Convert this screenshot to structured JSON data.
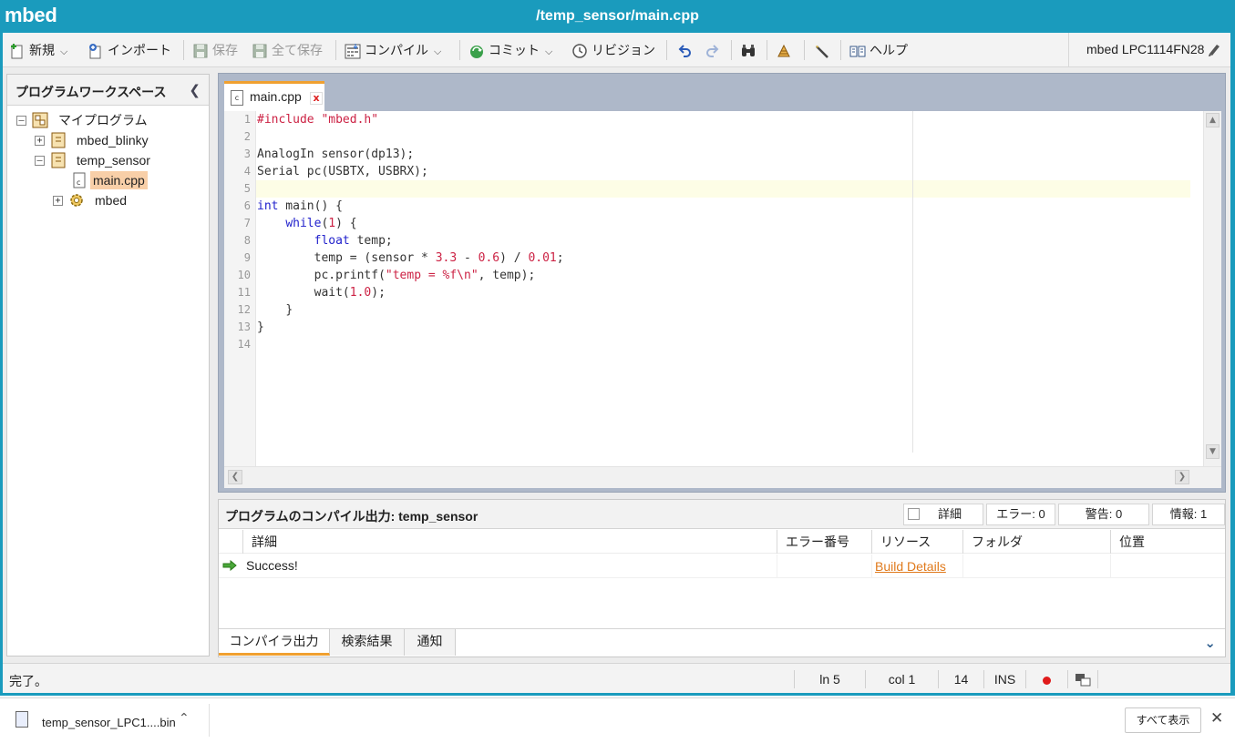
{
  "title_bar": {
    "brand": "mbed",
    "file_path": "/temp_sensor/main.cpp"
  },
  "toolbar": {
    "new_label": "新規",
    "import_label": "インポート",
    "save_label": "保存",
    "save_all_label": "全て保存",
    "compile_label": "コンパイル",
    "commit_label": "コミット",
    "revision_label": "リビジョン",
    "help_label": "ヘルプ",
    "device_label": "mbed LPC1114FN28"
  },
  "workspace": {
    "title": "プログラムワークスペース",
    "tree": {
      "root": "マイプログラム",
      "program1": "mbed_blinky",
      "program2": "temp_sensor",
      "file": "main.cpp",
      "library": "mbed"
    }
  },
  "editor": {
    "tab_label": "main.cpp",
    "tab_close": "x",
    "line_numbers": [
      "1",
      "2",
      "3",
      "4",
      "5",
      "6",
      "7",
      "8",
      "9",
      "10",
      "11",
      "12",
      "13",
      "14"
    ],
    "code": {
      "l1_pp": "#include \"mbed.h\"",
      "l3": "AnalogIn sensor(dp13);",
      "l4": "Serial pc(USBTX, USBRX);",
      "l6_kw": "int",
      "l6_rest": " main() {",
      "l7_kw": "while",
      "l7_a": "(",
      "l7_num": "1",
      "l7_b": ") {",
      "l8_kw": "float",
      "l8_rest": " temp;",
      "l9_a": "temp = (sensor * ",
      "l9_n1": "3.3",
      "l9_b": " - ",
      "l9_n2": "0.6",
      "l9_c": ") / ",
      "l9_n3": "0.01",
      "l9_d": ";",
      "l10_a": "pc.printf(",
      "l10_str": "\"temp = %f\\n\"",
      "l10_b": ", temp);",
      "l11_a": "wait(",
      "l11_num": "1.0",
      "l11_b": ");",
      "l12": "}",
      "l13": "}"
    }
  },
  "output": {
    "title": "プログラムのコンパイル出力: temp_sensor",
    "detail_toggle": "詳細",
    "errors": "エラー: 0",
    "warnings": "警告: 0",
    "info": "情報: 1",
    "columns": [
      "詳細",
      "エラー番号",
      "リソース",
      "フォルダ",
      "位置"
    ],
    "row": {
      "message": "Success!",
      "resource_link": "Build Details"
    },
    "tabs": [
      "コンパイラ出力",
      "検索結果",
      "通知"
    ]
  },
  "statusbar": {
    "message": "完了。",
    "line": "ln 5",
    "col": "col 1",
    "num": "14",
    "mode": "INS"
  },
  "download": {
    "filename": "temp_sensor_LPC1....bin",
    "show_all": "すべて表示"
  }
}
